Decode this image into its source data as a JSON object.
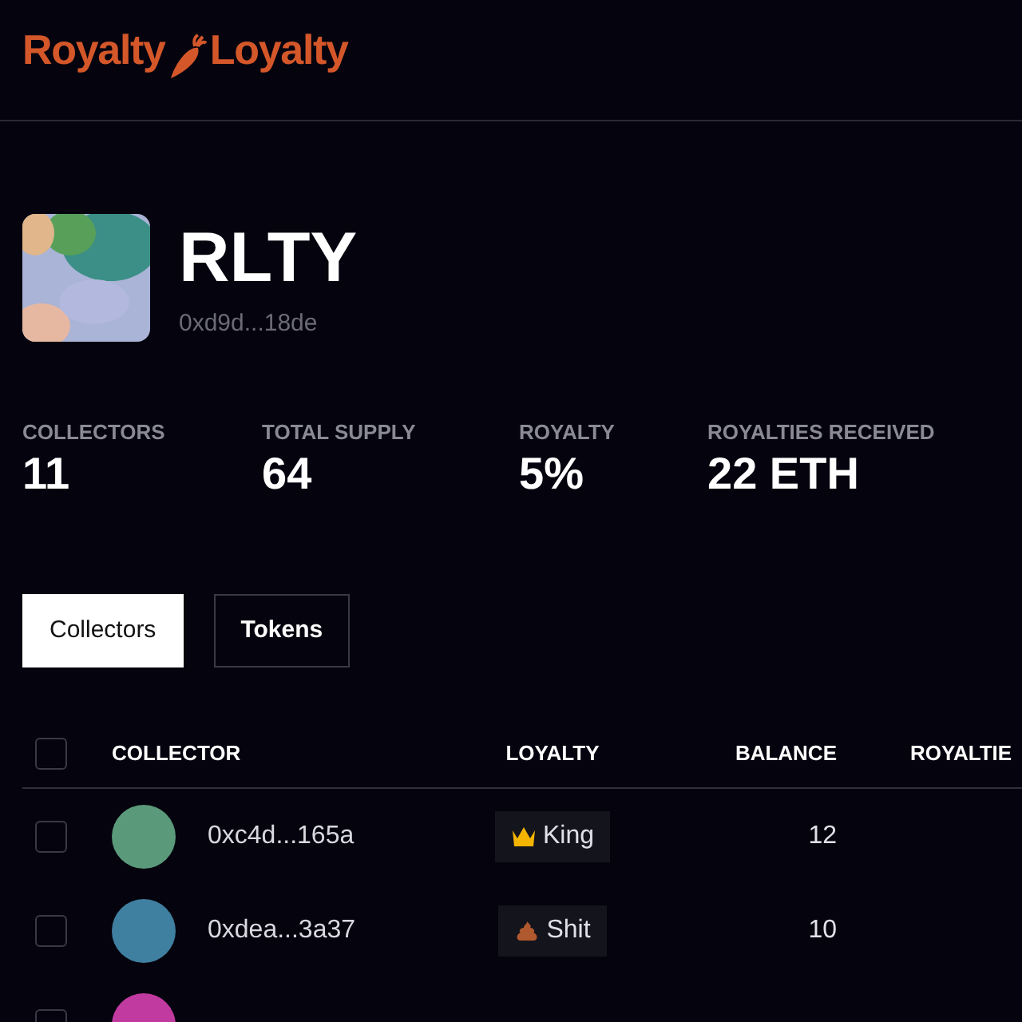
{
  "logo": {
    "left": "Royalty",
    "right": "Loyalty"
  },
  "token": {
    "name": "RLTY",
    "address": "0xd9d...18de"
  },
  "stats": [
    {
      "label": "COLLECTORS",
      "value": "11"
    },
    {
      "label": "TOTAL SUPPLY",
      "value": "64"
    },
    {
      "label": "ROYALTY",
      "value": "5%"
    },
    {
      "label": "ROYALTIES RECEIVED",
      "value": "22 ETH"
    }
  ],
  "tabs": [
    {
      "label": "Collectors",
      "selected": true
    },
    {
      "label": "Tokens",
      "selected": false
    }
  ],
  "table": {
    "select_all": {
      "checked": false
    },
    "columns": [
      "COLLECTOR",
      "LOYALTY",
      "BALANCE",
      "ROYALTIE"
    ],
    "rows": [
      {
        "checked": false,
        "color": "#5a9a7a",
        "address": "0xc4d...165a",
        "loyalty": {
          "kind": "crown",
          "label": "King"
        },
        "balance": "12"
      },
      {
        "checked": false,
        "color": "#3f7fa0",
        "address": "0xdea...3a37",
        "loyalty": {
          "kind": "poop",
          "label": "Shit"
        },
        "balance": "10"
      },
      {
        "checked": false,
        "color": "#c03aa0"
      }
    ]
  }
}
